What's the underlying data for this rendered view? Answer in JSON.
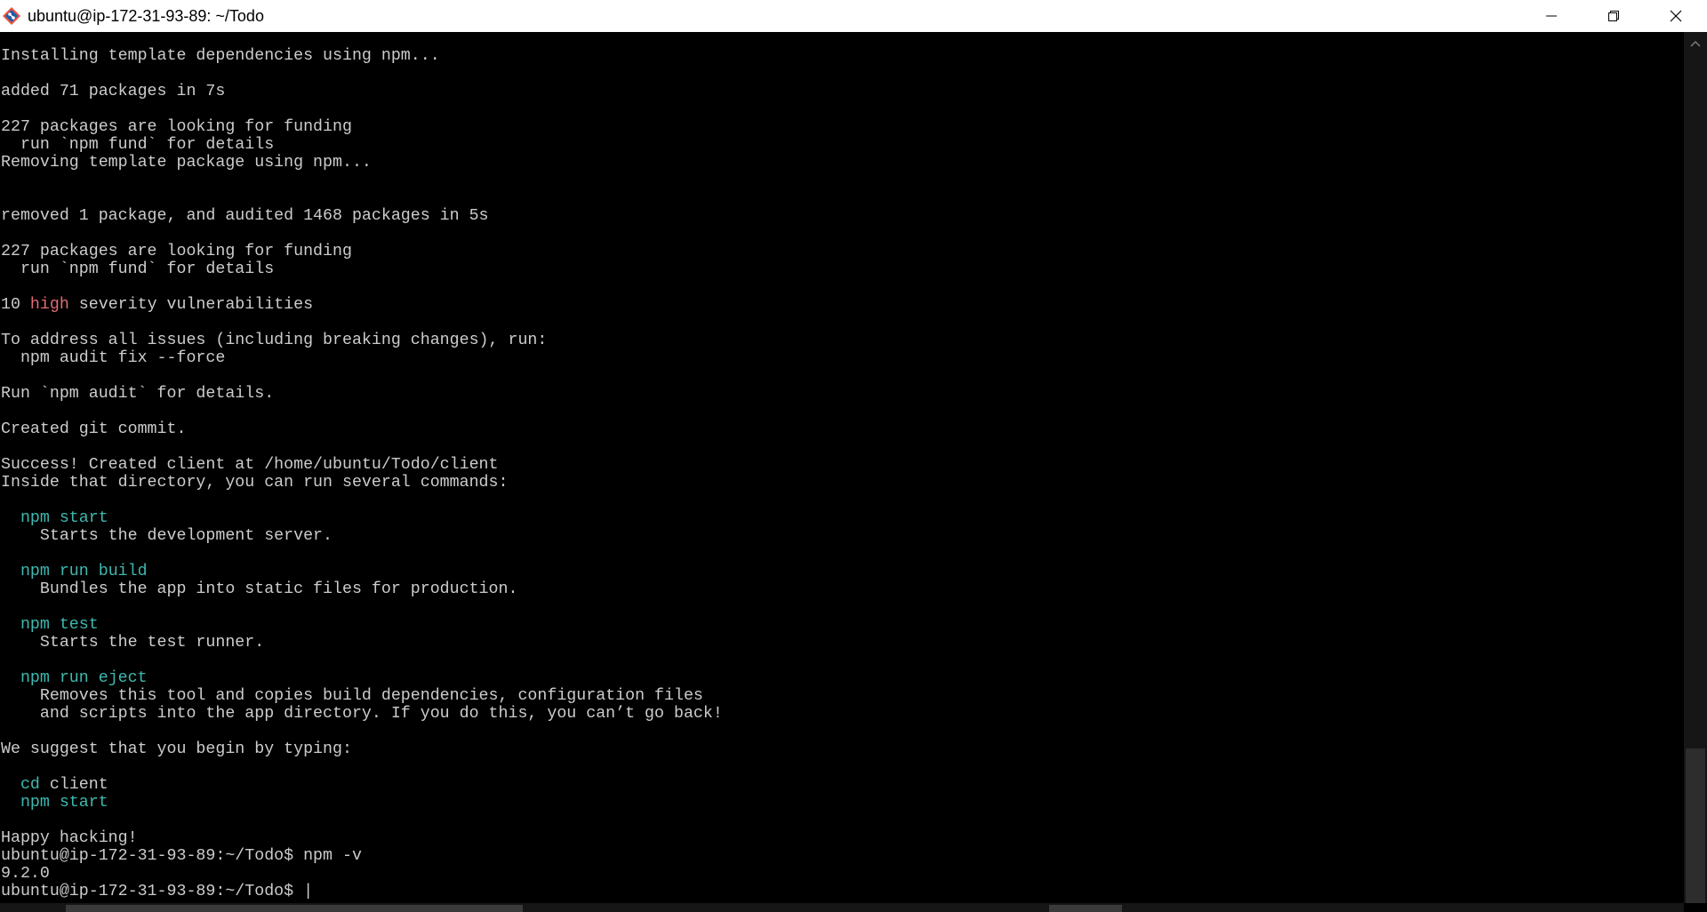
{
  "window": {
    "title": "ubuntu@ip-172-31-93-89: ~/Todo",
    "controls": {
      "minimize": "minimize",
      "maximize": "restore",
      "close": "close"
    }
  },
  "colors": {
    "background": "#000000",
    "text": "#cccccc",
    "red": "#e06b74",
    "cyan": "#3fb8b0"
  },
  "terminal": {
    "lines": [
      [
        {
          "text": "Installing template dependencies using npm..."
        }
      ],
      [],
      [
        {
          "text": "added 71 packages in 7s"
        }
      ],
      [],
      [
        {
          "text": "227 packages are looking for funding"
        }
      ],
      [
        {
          "text": "  run `npm fund` for details"
        }
      ],
      [
        {
          "text": "Removing template package using npm..."
        }
      ],
      [],
      [],
      [
        {
          "text": "removed 1 package, and audited 1468 packages in 5s"
        }
      ],
      [],
      [
        {
          "text": "227 packages are looking for funding"
        }
      ],
      [
        {
          "text": "  run `npm fund` for details"
        }
      ],
      [],
      [
        {
          "text": "10 "
        },
        {
          "text": "high",
          "color": "red"
        },
        {
          "text": " severity vulnerabilities"
        }
      ],
      [],
      [
        {
          "text": "To address all issues (including breaking changes), run:"
        }
      ],
      [
        {
          "text": "  npm audit fix --force"
        }
      ],
      [],
      [
        {
          "text": "Run `npm audit` for details."
        }
      ],
      [],
      [
        {
          "text": "Created git commit."
        }
      ],
      [],
      [
        {
          "text": "Success! Created client at /home/ubuntu/Todo/client"
        }
      ],
      [
        {
          "text": "Inside that directory, you can run several commands:"
        }
      ],
      [],
      [
        {
          "text": "  "
        },
        {
          "text": "npm start",
          "color": "cyan"
        }
      ],
      [
        {
          "text": "    Starts the development server."
        }
      ],
      [],
      [
        {
          "text": "  "
        },
        {
          "text": "npm run build",
          "color": "cyan"
        }
      ],
      [
        {
          "text": "    Bundles the app into static files for production."
        }
      ],
      [],
      [
        {
          "text": "  "
        },
        {
          "text": "npm test",
          "color": "cyan"
        }
      ],
      [
        {
          "text": "    Starts the test runner."
        }
      ],
      [],
      [
        {
          "text": "  "
        },
        {
          "text": "npm run eject",
          "color": "cyan"
        }
      ],
      [
        {
          "text": "    Removes this tool and copies build dependencies, configuration files"
        }
      ],
      [
        {
          "text": "    and scripts into the app directory. If you do this, you can’t go back!"
        }
      ],
      [],
      [
        {
          "text": "We suggest that you begin by typing:"
        }
      ],
      [],
      [
        {
          "text": "  "
        },
        {
          "text": "cd",
          "color": "cyan"
        },
        {
          "text": " client"
        }
      ],
      [
        {
          "text": "  "
        },
        {
          "text": "npm start",
          "color": "cyan"
        }
      ],
      [],
      [
        {
          "text": "Happy hacking!"
        }
      ],
      [
        {
          "text": "ubuntu@ip-172-31-93-89:~/Todo$ npm -v"
        }
      ],
      [
        {
          "text": "9.2.0"
        }
      ],
      [
        {
          "text": "ubuntu@ip-172-31-93-89:~/Todo$ "
        },
        {
          "text": "|",
          "cursor": true
        }
      ]
    ]
  }
}
